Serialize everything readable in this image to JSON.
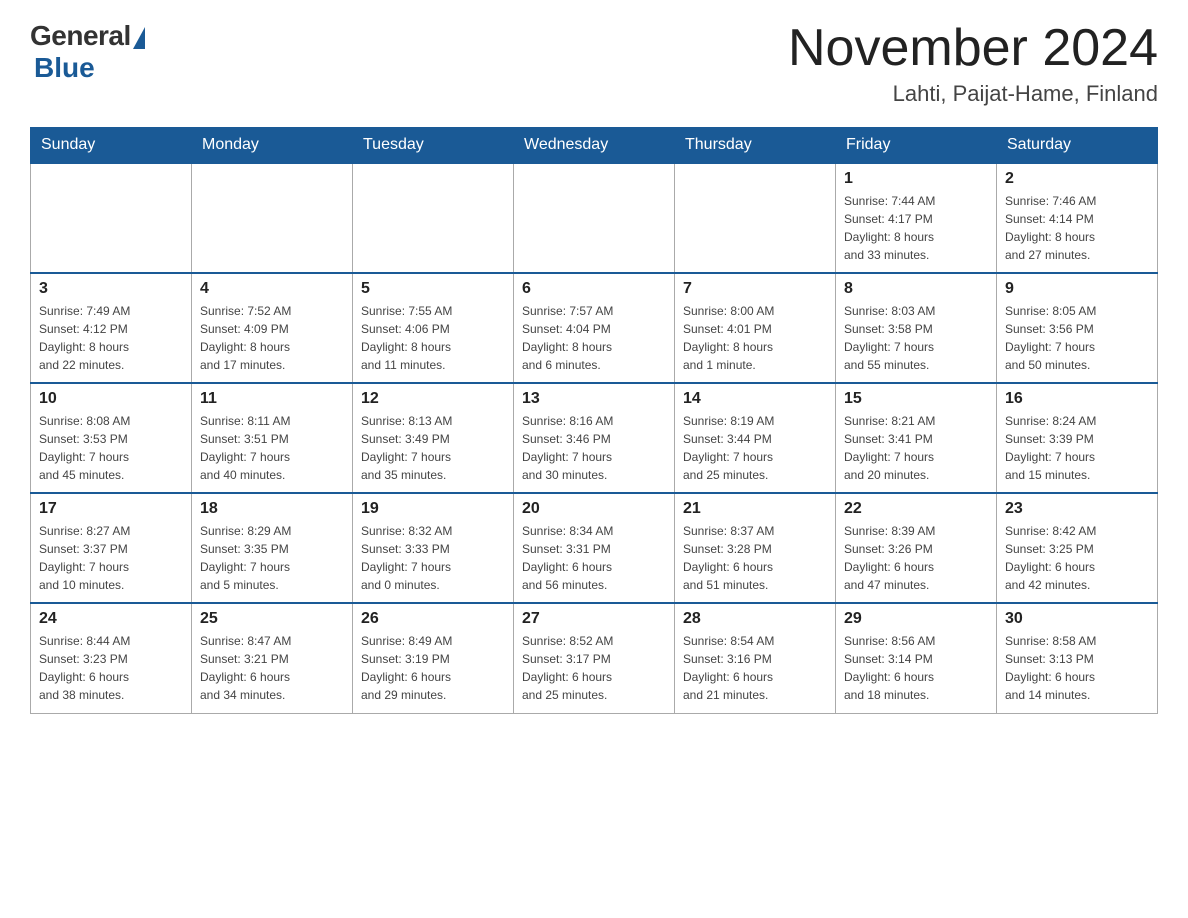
{
  "header": {
    "logo_general": "General",
    "logo_blue": "Blue",
    "title": "November 2024",
    "subtitle": "Lahti, Paijat-Hame, Finland"
  },
  "weekdays": [
    "Sunday",
    "Monday",
    "Tuesday",
    "Wednesday",
    "Thursday",
    "Friday",
    "Saturday"
  ],
  "weeks": [
    [
      {
        "day": "",
        "info": ""
      },
      {
        "day": "",
        "info": ""
      },
      {
        "day": "",
        "info": ""
      },
      {
        "day": "",
        "info": ""
      },
      {
        "day": "",
        "info": ""
      },
      {
        "day": "1",
        "info": "Sunrise: 7:44 AM\nSunset: 4:17 PM\nDaylight: 8 hours\nand 33 minutes."
      },
      {
        "day": "2",
        "info": "Sunrise: 7:46 AM\nSunset: 4:14 PM\nDaylight: 8 hours\nand 27 minutes."
      }
    ],
    [
      {
        "day": "3",
        "info": "Sunrise: 7:49 AM\nSunset: 4:12 PM\nDaylight: 8 hours\nand 22 minutes."
      },
      {
        "day": "4",
        "info": "Sunrise: 7:52 AM\nSunset: 4:09 PM\nDaylight: 8 hours\nand 17 minutes."
      },
      {
        "day": "5",
        "info": "Sunrise: 7:55 AM\nSunset: 4:06 PM\nDaylight: 8 hours\nand 11 minutes."
      },
      {
        "day": "6",
        "info": "Sunrise: 7:57 AM\nSunset: 4:04 PM\nDaylight: 8 hours\nand 6 minutes."
      },
      {
        "day": "7",
        "info": "Sunrise: 8:00 AM\nSunset: 4:01 PM\nDaylight: 8 hours\nand 1 minute."
      },
      {
        "day": "8",
        "info": "Sunrise: 8:03 AM\nSunset: 3:58 PM\nDaylight: 7 hours\nand 55 minutes."
      },
      {
        "day": "9",
        "info": "Sunrise: 8:05 AM\nSunset: 3:56 PM\nDaylight: 7 hours\nand 50 minutes."
      }
    ],
    [
      {
        "day": "10",
        "info": "Sunrise: 8:08 AM\nSunset: 3:53 PM\nDaylight: 7 hours\nand 45 minutes."
      },
      {
        "day": "11",
        "info": "Sunrise: 8:11 AM\nSunset: 3:51 PM\nDaylight: 7 hours\nand 40 minutes."
      },
      {
        "day": "12",
        "info": "Sunrise: 8:13 AM\nSunset: 3:49 PM\nDaylight: 7 hours\nand 35 minutes."
      },
      {
        "day": "13",
        "info": "Sunrise: 8:16 AM\nSunset: 3:46 PM\nDaylight: 7 hours\nand 30 minutes."
      },
      {
        "day": "14",
        "info": "Sunrise: 8:19 AM\nSunset: 3:44 PM\nDaylight: 7 hours\nand 25 minutes."
      },
      {
        "day": "15",
        "info": "Sunrise: 8:21 AM\nSunset: 3:41 PM\nDaylight: 7 hours\nand 20 minutes."
      },
      {
        "day": "16",
        "info": "Sunrise: 8:24 AM\nSunset: 3:39 PM\nDaylight: 7 hours\nand 15 minutes."
      }
    ],
    [
      {
        "day": "17",
        "info": "Sunrise: 8:27 AM\nSunset: 3:37 PM\nDaylight: 7 hours\nand 10 minutes."
      },
      {
        "day": "18",
        "info": "Sunrise: 8:29 AM\nSunset: 3:35 PM\nDaylight: 7 hours\nand 5 minutes."
      },
      {
        "day": "19",
        "info": "Sunrise: 8:32 AM\nSunset: 3:33 PM\nDaylight: 7 hours\nand 0 minutes."
      },
      {
        "day": "20",
        "info": "Sunrise: 8:34 AM\nSunset: 3:31 PM\nDaylight: 6 hours\nand 56 minutes."
      },
      {
        "day": "21",
        "info": "Sunrise: 8:37 AM\nSunset: 3:28 PM\nDaylight: 6 hours\nand 51 minutes."
      },
      {
        "day": "22",
        "info": "Sunrise: 8:39 AM\nSunset: 3:26 PM\nDaylight: 6 hours\nand 47 minutes."
      },
      {
        "day": "23",
        "info": "Sunrise: 8:42 AM\nSunset: 3:25 PM\nDaylight: 6 hours\nand 42 minutes."
      }
    ],
    [
      {
        "day": "24",
        "info": "Sunrise: 8:44 AM\nSunset: 3:23 PM\nDaylight: 6 hours\nand 38 minutes."
      },
      {
        "day": "25",
        "info": "Sunrise: 8:47 AM\nSunset: 3:21 PM\nDaylight: 6 hours\nand 34 minutes."
      },
      {
        "day": "26",
        "info": "Sunrise: 8:49 AM\nSunset: 3:19 PM\nDaylight: 6 hours\nand 29 minutes."
      },
      {
        "day": "27",
        "info": "Sunrise: 8:52 AM\nSunset: 3:17 PM\nDaylight: 6 hours\nand 25 minutes."
      },
      {
        "day": "28",
        "info": "Sunrise: 8:54 AM\nSunset: 3:16 PM\nDaylight: 6 hours\nand 21 minutes."
      },
      {
        "day": "29",
        "info": "Sunrise: 8:56 AM\nSunset: 3:14 PM\nDaylight: 6 hours\nand 18 minutes."
      },
      {
        "day": "30",
        "info": "Sunrise: 8:58 AM\nSunset: 3:13 PM\nDaylight: 6 hours\nand 14 minutes."
      }
    ]
  ]
}
